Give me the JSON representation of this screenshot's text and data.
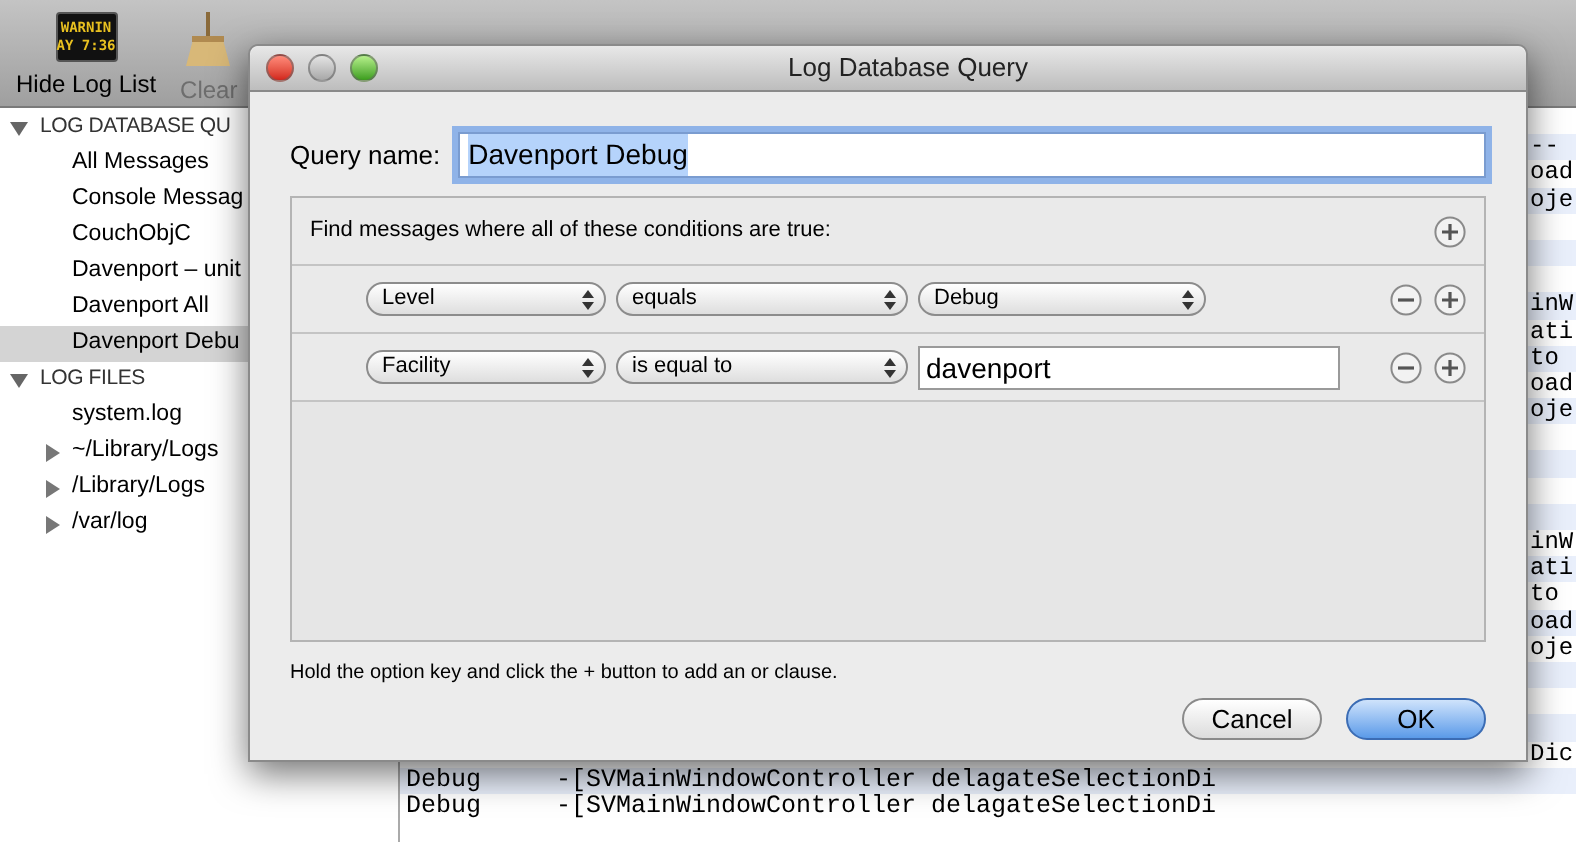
{
  "toolbar": {
    "items": [
      {
        "kind": "log-badge",
        "label": "Hide Log List",
        "badge_lines": [
          "WARNIN",
          "AY 7:36"
        ],
        "disabled": false
      },
      {
        "kind": "broom",
        "label": "Clear",
        "disabled": true
      }
    ]
  },
  "sidebar": {
    "sections": [
      {
        "title": "LOG DATABASE QU",
        "expanded": true,
        "items": [
          {
            "label": "All Messages",
            "selected": false
          },
          {
            "label": "Console Messag",
            "selected": false
          },
          {
            "label": "CouchObjC",
            "selected": false
          },
          {
            "label": "Davenport – unit",
            "selected": false
          },
          {
            "label": "Davenport All",
            "selected": false
          },
          {
            "label": "Davenport Debu",
            "selected": true
          }
        ]
      },
      {
        "title": "LOG FILES",
        "expanded": true,
        "items": [
          {
            "label": "system.log",
            "selected": false
          },
          {
            "label": "~/Library/Logs",
            "selected": false,
            "expanded": false
          },
          {
            "label": "/Library/Logs",
            "selected": false,
            "expanded": false
          },
          {
            "label": "/var/log",
            "selected": false,
            "expanded": false
          }
        ]
      }
    ]
  },
  "log": {
    "fragments": [
      "--",
      "oad",
      "oje",
      "inW",
      "ati",
      "to",
      "oad",
      "oje",
      "inW",
      "ati",
      "to",
      "oad",
      "oje",
      "Dic"
    ],
    "full_rows": [
      {
        "level": "Debug",
        "message": "-[SVMainWindowController delagateSelectionDi"
      },
      {
        "level": "Debug",
        "message": "-[SVMainWindowController delagateSelectionDi"
      }
    ]
  },
  "dialog": {
    "title": "Log Database Query",
    "query_name_label": "Query name:",
    "query_name": "Davenport Debug",
    "query_name_selected": true,
    "header": "Find messages where all of these conditions are true:",
    "conditions": [
      {
        "field": "Level",
        "operator": "equals",
        "kind": "popup",
        "value": "Debug"
      },
      {
        "field": "Facility",
        "operator": "is equal to",
        "kind": "text",
        "value": "davenport"
      }
    ],
    "hint": "Hold the option key and click the + button to add an or clause.",
    "buttons": [
      {
        "label": "Cancel",
        "default": false
      },
      {
        "label": "OK",
        "default": true
      }
    ]
  }
}
